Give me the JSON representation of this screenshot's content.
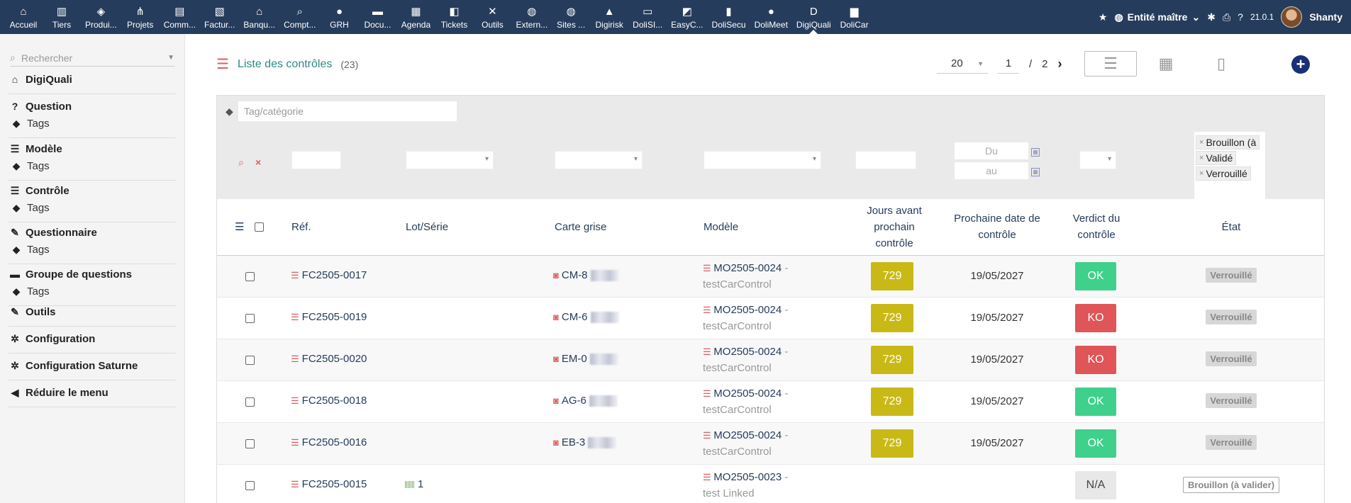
{
  "topmenu": [
    {
      "label": "Accueil",
      "icon": "home-icon",
      "glyph": "⌂"
    },
    {
      "label": "Tiers",
      "icon": "building-icon",
      "glyph": "▥"
    },
    {
      "label": "Produi...",
      "icon": "cube-icon",
      "glyph": "◈"
    },
    {
      "label": "Projets",
      "icon": "sitemap-icon",
      "glyph": "⋔"
    },
    {
      "label": "Comm...",
      "icon": "suitcase-icon",
      "glyph": "▤"
    },
    {
      "label": "Factur...",
      "icon": "invoice-icon",
      "glyph": "▧"
    },
    {
      "label": "Banqu...",
      "icon": "bank-icon",
      "glyph": "⌂"
    },
    {
      "label": "Compt...",
      "icon": "search-dollar-icon",
      "glyph": "⌕"
    },
    {
      "label": "GRH",
      "icon": "user-icon",
      "glyph": "●"
    },
    {
      "label": "Docu...",
      "icon": "folder-icon",
      "glyph": "▬"
    },
    {
      "label": "Agenda",
      "icon": "calendar-icon",
      "glyph": "▦"
    },
    {
      "label": "Tickets",
      "icon": "ticket-icon",
      "glyph": "◧"
    },
    {
      "label": "Outils",
      "icon": "tools-icon",
      "glyph": "✕"
    },
    {
      "label": "Extern...",
      "icon": "globe-icon",
      "glyph": "◍"
    },
    {
      "label": "Sites ...",
      "icon": "globe-icon",
      "glyph": "◍"
    },
    {
      "label": "Digirisk",
      "icon": "digirisk-logo-icon",
      "glyph": "▲"
    },
    {
      "label": "DoliSI...",
      "icon": "id-card-icon",
      "glyph": "▭"
    },
    {
      "label": "EasyC...",
      "icon": "easycrm-icon",
      "glyph": "◩"
    },
    {
      "label": "DoliSecu",
      "icon": "lock-icon",
      "glyph": "▮"
    },
    {
      "label": "DoliMeet",
      "icon": "users-icon",
      "glyph": "●"
    },
    {
      "label": "DigiQuali",
      "icon": "digiquali-logo-icon",
      "glyph": "D"
    },
    {
      "label": "DoliCar",
      "icon": "garage-icon",
      "glyph": "▆"
    }
  ],
  "topmenu_active": "DigiQuali",
  "topright": {
    "entity": "Entité maître",
    "version": "21.0.1",
    "user": "Shanty"
  },
  "leftmenu": {
    "search_placeholder": "Rechercher",
    "sections": [
      {
        "title": "DigiQuali",
        "icon": "home-icon",
        "sub": null
      },
      {
        "title": "Question",
        "icon": "question-icon",
        "sub": "Tags"
      },
      {
        "title": "Modèle",
        "icon": "list-icon",
        "sub": "Tags"
      },
      {
        "title": "Contrôle",
        "icon": "tasks-icon",
        "sub": "Tags"
      },
      {
        "title": "Questionnaire",
        "icon": "pen-icon",
        "sub": "Tags"
      },
      {
        "title": "Groupe de questions",
        "icon": "folder-icon",
        "sub": "Tags"
      },
      {
        "title": "Outils",
        "icon": "wrench-icon",
        "sub": null
      },
      {
        "title": "Configuration",
        "icon": "gear-icon",
        "sub": null
      },
      {
        "title": "Configuration Saturne",
        "icon": "gear-icon",
        "sub": null
      },
      {
        "title": "Réduire le menu",
        "icon": "chevron-left-icon",
        "sub": null
      }
    ]
  },
  "page": {
    "title": "Liste des contrôles",
    "count": "(23)",
    "pager": {
      "per_page": "20",
      "page": "1",
      "separator": "/",
      "total_pages": "2"
    },
    "tag_filter_placeholder": "Tag/catégorie",
    "date_from_placeholder": "Du",
    "date_to_placeholder": "au",
    "status_chips": [
      "Brouillon (à",
      "Validé",
      "Verrouillé"
    ]
  },
  "table": {
    "headers": {
      "ref": "Réf.",
      "lot": "Lot/Série",
      "car": "Carte grise",
      "model": "Modèle",
      "days_line1": "Jours avant",
      "days_line2": "prochain",
      "days_line3": "contrôle",
      "date_line1": "Prochaine date de",
      "date_line2": "contrôle",
      "verdict_line1": "Verdict du",
      "verdict_line2": "contrôle",
      "state": "État"
    },
    "rows": [
      {
        "ref": "FC2505-0017",
        "lot": "",
        "car": "CM-8",
        "model_ref": "MO2505-0024",
        "model_label": "testCarControl",
        "days": "729",
        "date": "19/05/2027",
        "verdict": "OK",
        "verdict_color": "#3fd08b",
        "state": "Verrouillé",
        "state_type": "locked"
      },
      {
        "ref": "FC2505-0019",
        "lot": "",
        "car": "CM-6",
        "model_ref": "MO2505-0024",
        "model_label": "testCarControl",
        "days": "729",
        "date": "19/05/2027",
        "verdict": "KO",
        "verdict_color": "#e05557",
        "state": "Verrouillé",
        "state_type": "locked"
      },
      {
        "ref": "FC2505-0020",
        "lot": "",
        "car": "EM-0",
        "model_ref": "MO2505-0024",
        "model_label": "testCarControl",
        "days": "729",
        "date": "19/05/2027",
        "verdict": "KO",
        "verdict_color": "#e05557",
        "state": "Verrouillé",
        "state_type": "locked"
      },
      {
        "ref": "FC2505-0018",
        "lot": "",
        "car": "AG-6",
        "model_ref": "MO2505-0024",
        "model_label": "testCarControl",
        "days": "729",
        "date": "19/05/2027",
        "verdict": "OK",
        "verdict_color": "#3fd08b",
        "state": "Verrouillé",
        "state_type": "locked"
      },
      {
        "ref": "FC2505-0016",
        "lot": "",
        "car": "EB-3",
        "model_ref": "MO2505-0024",
        "model_label": "testCarControl",
        "days": "729",
        "date": "19/05/2027",
        "verdict": "OK",
        "verdict_color": "#3fd08b",
        "state": "Verrouillé",
        "state_type": "locked"
      },
      {
        "ref": "FC2505-0015",
        "lot": "1",
        "car": "",
        "model_ref": "MO2505-0023",
        "model_label": "test Linked",
        "days": "",
        "date": "",
        "verdict": "N/A",
        "verdict_color": "#e8e8e8",
        "state": "Brouillon (à valider)",
        "state_type": "draft"
      }
    ]
  },
  "colors": {
    "topbar": "#263c5c",
    "accent_red": "#e05d5d",
    "title_teal": "#2a8a85",
    "days_badge": "#c9b916",
    "add_button": "#1b2f77"
  }
}
